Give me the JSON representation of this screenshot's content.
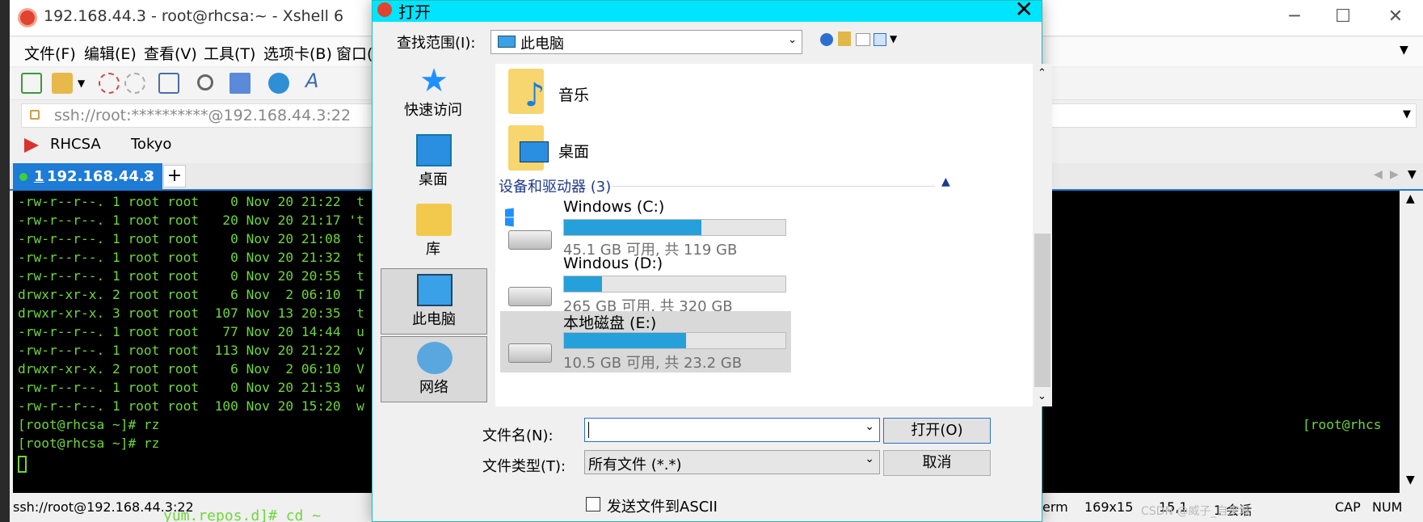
{
  "xshell": {
    "title": "192.168.44.3 - root@rhcsa:~ - Xshell 6",
    "menu": [
      "文件(F)",
      "编辑(E)",
      "查看(V)",
      "工具(T)",
      "选项卡(B)",
      "窗口(W)"
    ],
    "address": "ssh://root:**********@192.168.44.3:22",
    "links": [
      "RHCSA",
      "Tokyo"
    ],
    "tab_number": "1",
    "tab_label": "192.168.44.3",
    "tab_close": "×",
    "tab_add": "+",
    "terminal_lines": [
      "-rw-r--r--. 1 root root    0 Nov 20 21:22  t",
      "-rw-r--r--. 1 root root   20 Nov 20 21:17 't",
      "-rw-r--r--. 1 root root    0 Nov 20 21:08  t",
      "-rw-r--r--. 1 root root    0 Nov 20 21:32  t",
      "-rw-r--r--. 1 root root    0 Nov 20 20:55  t",
      "drwxr-xr-x. 2 root root    6 Nov  2 06:10  T",
      "drwxr-xr-x. 3 root root  107 Nov 13 20:35  t",
      "-rw-r--r--. 1 root root   77 Nov 20 14:44  u",
      "-rw-r--r--. 1 root root  113 Nov 20 21:22  v",
      "drwxr-xr-x. 2 root root    6 Nov  2 06:10  V",
      "-rw-r--r--. 1 root root    0 Nov 20 21:53  w",
      "-rw-r--r--. 1 root root  100 Nov 20 15:20  w",
      "[root@rhcsa ~]# rz",
      "[root@rhcsa ~]# rz"
    ],
    "right_prompt": "[root@rhcs",
    "status": {
      "connection": "ssh://root@192.168.44.3:22",
      "term": "erm",
      "size": "169x15",
      "cursor": "15,1",
      "sessions": "1 会话",
      "caps": "CAP",
      "num": "NUM"
    },
    "background_text": "yum.repos.d]# cd ~",
    "watermark": "CSDN @威子_自来城"
  },
  "dialog": {
    "title": "打开",
    "look_in_label": "查找范围(I):",
    "look_in_value": "此电脑",
    "places": [
      "快速访问",
      "桌面",
      "库",
      "此电脑",
      "网络"
    ],
    "selected_place": "此电脑",
    "folders": [
      "音乐",
      "桌面"
    ],
    "group_header": "设备和驱动器 (3)",
    "drives": [
      {
        "name": "Windows (C:)",
        "free": "45.1 GB 可用, 共 119 GB",
        "used_fraction": 0.62
      },
      {
        "name": "Windous  (D:)",
        "free": "265 GB 可用, 共 320 GB",
        "used_fraction": 0.17
      },
      {
        "name": "本地磁盘 (E:)",
        "free": "10.5 GB 可用, 共 23.2 GB",
        "used_fraction": 0.55
      }
    ],
    "filename_label": "文件名(N):",
    "filename_value": "",
    "filetype_label": "文件类型(T):",
    "filetype_value": "所有文件 (*.*)",
    "open_button": "打开(O)",
    "cancel_button": "取消",
    "ascii_checkbox": "发送文件到ASCII",
    "ascii_checked": false
  },
  "colors": {
    "dialog_title_bg": "#00e5ff",
    "terminal_fg": "#6fd63b",
    "tab_active": "#1e7bd6",
    "drive_bar": "#26a0da"
  }
}
